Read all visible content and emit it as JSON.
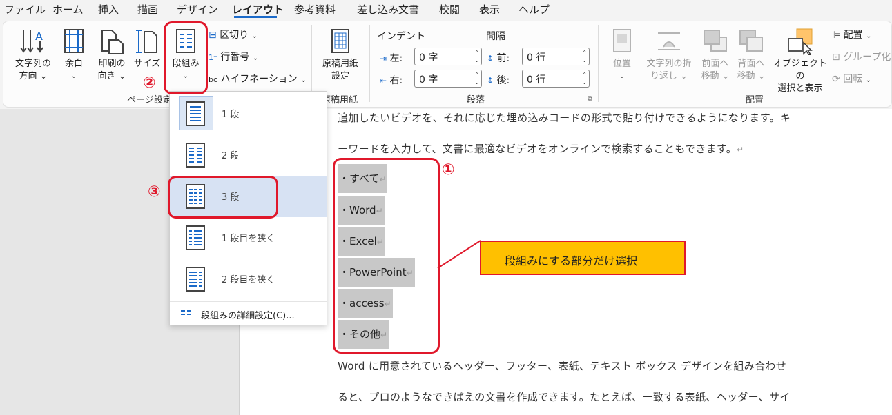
{
  "menu": {
    "tabs": [
      "ファイル",
      "ホーム",
      "挿入",
      "描画",
      "デザイン",
      "レイアウト",
      "参考資料",
      "差し込み文書",
      "校閲",
      "表示",
      "ヘルプ"
    ]
  },
  "ribbon": {
    "page_setup": {
      "text_direction": [
        "文字列の",
        "方向 ⌄"
      ],
      "margins": [
        "余白",
        "⌄"
      ],
      "orientation": [
        "印刷の",
        "向き ⌄"
      ],
      "size": "サイズ",
      "columns": "段組み",
      "breaks": "区切り",
      "line_numbers": "行番号",
      "hyphenation": "ハイフネーション",
      "group_label": "ページ設定"
    },
    "genkou": {
      "button": [
        "原稿用紙",
        "設定"
      ],
      "group_label": "原稿用紙"
    },
    "paragraph": {
      "indent_title": "インデント",
      "spacing_title": "間隔",
      "left_label": "左:",
      "right_label": "右:",
      "before_label": "前:",
      "after_label": "後:",
      "left_value": "0 字",
      "right_value": "0 字",
      "before_value": "0 行",
      "after_value": "0 行",
      "group_label": "段落"
    },
    "arrange": {
      "position": "位置",
      "wrap_text": [
        "文字列の折",
        "り返し ⌄"
      ],
      "bring_forward": [
        "前面へ",
        "移動 ⌄"
      ],
      "send_backward": [
        "背面へ",
        "移動 ⌄"
      ],
      "selection_pane": [
        "オブジェクトの",
        "選択と表示"
      ],
      "align": "配置",
      "group": "グループ化",
      "rotate": "回転",
      "group_label": "配置"
    }
  },
  "columns_menu": {
    "items": [
      "1 段",
      "2 段",
      "3 段",
      "1 段目を狭く",
      "2 段目を狭く"
    ],
    "footer": "段組みの詳細設定(C)..."
  },
  "document": {
    "para1_line1": "追加したいビデオを、それに応じた埋め込みコードの形式で貼り付けできるようになります。キ",
    "para1_line2": "ーワードを入力して、文書に最適なビデオをオンラインで検索することもできます。",
    "bullets": [
      "・すべて",
      "・Word",
      "・Excel",
      "・PowerPoint",
      "・access",
      "・その他"
    ],
    "para2_line1": "Word に用意されているヘッダー、フッター、表紙、テキスト ボックス デザインを組み合わせ",
    "para2_line2": "ると、プロのようなできばえの文書を作成できます。たとえば、一致する表紙、ヘッダー、サイ",
    "return_mark": "↵"
  },
  "annotations": {
    "num1": "①",
    "num2": "②",
    "num3": "③",
    "callout": "段組みにする部分だけ選択"
  },
  "colors": {
    "accent": "#1b6ac9",
    "annotation_red": "#e0182b",
    "callout_fill": "#ffc000",
    "selection_gray": "#c8c8c8"
  }
}
